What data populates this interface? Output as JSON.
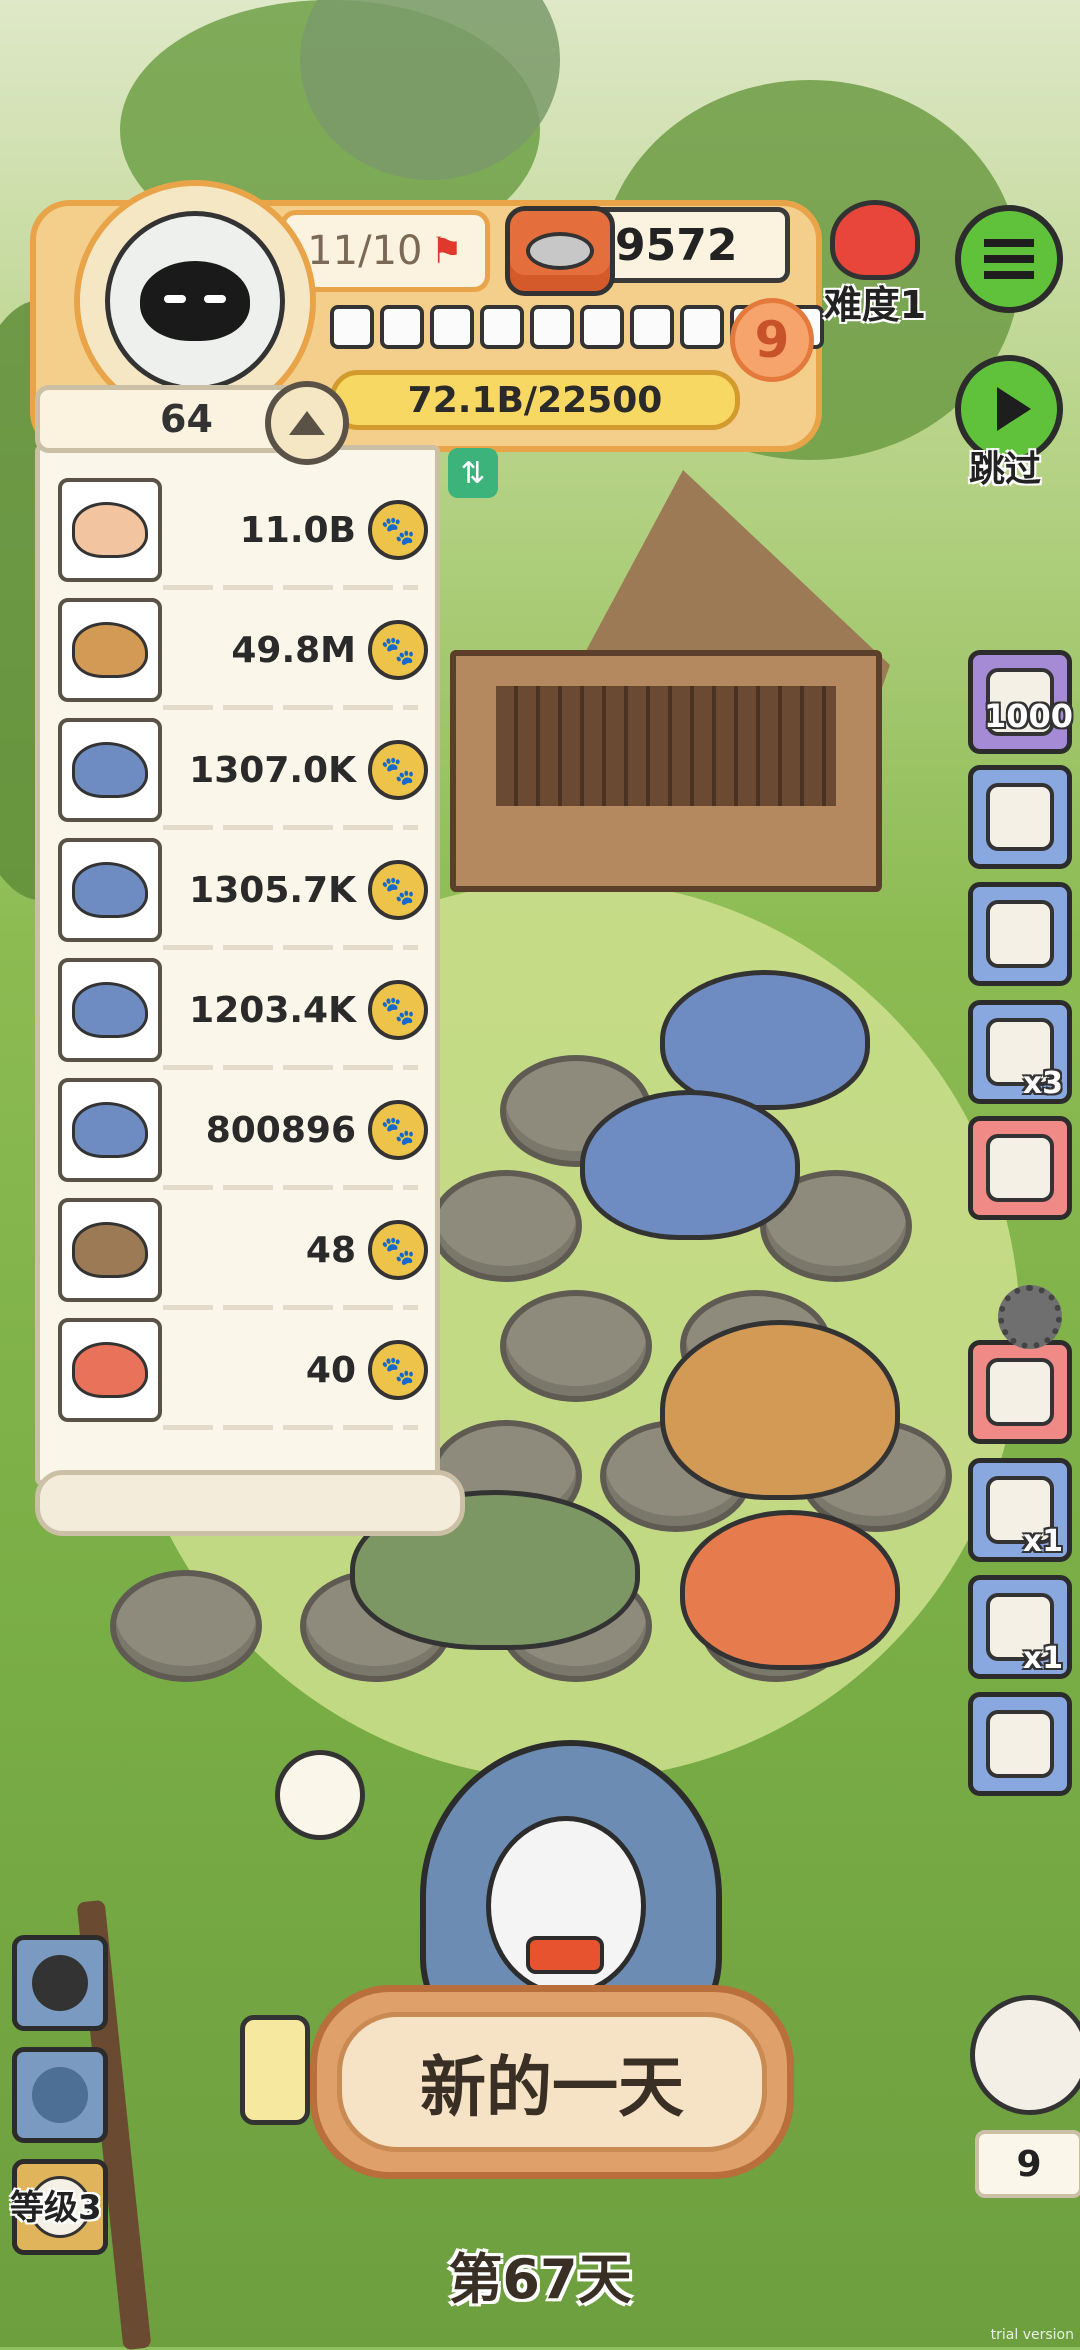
{
  "hud": {
    "progress_text": "11/10",
    "coins": "9572",
    "level": "9",
    "xp_text": "72.1B/22500",
    "xp_fraction": 0.2,
    "pip_count": 10
  },
  "difficulty_label": "难度1",
  "skip_label": "跳过",
  "list": {
    "header_count": "64",
    "rows": [
      {
        "creature": "donut-icon",
        "value": "11.0B"
      },
      {
        "creature": "trex-icon",
        "value": "49.8M"
      },
      {
        "creature": "plesiosaur-icon",
        "value": "1307.0K"
      },
      {
        "creature": "plesiosaur-icon",
        "value": "1305.7K"
      },
      {
        "creature": "plesiosaur-icon",
        "value": "1203.4K"
      },
      {
        "creature": "plesiosaur-icon",
        "value": "800896"
      },
      {
        "creature": "brontosaurus-icon",
        "value": "48"
      },
      {
        "creature": "singing-dino-icon",
        "value": "40"
      }
    ]
  },
  "items": [
    {
      "name": "film-reel-item",
      "label": "1000",
      "color": "#a58ad6"
    },
    {
      "name": "backpack-item",
      "label": "",
      "color": "#8aa8e0"
    },
    {
      "name": "food-jar-item",
      "label": "",
      "color": "#8aa8e0"
    },
    {
      "name": "axe-item",
      "label": "x3",
      "color": "#8aa8e0"
    },
    {
      "name": "bone-item",
      "label": "",
      "color": "#f08a86"
    },
    {
      "name": "green-potion-item",
      "label": "",
      "color": "#f08a86"
    },
    {
      "name": "donut-item",
      "label": "x1",
      "color": "#8aa8e0"
    },
    {
      "name": "tin-can-item",
      "label": "x1",
      "color": "#8aa8e0"
    },
    {
      "name": "jar-item",
      "label": "",
      "color": "#8aa8e0"
    }
  ],
  "level_label": "等级3",
  "new_day_label": "新的一天",
  "day_label": "第67天",
  "owl_count": "9",
  "watermark": "trial version"
}
